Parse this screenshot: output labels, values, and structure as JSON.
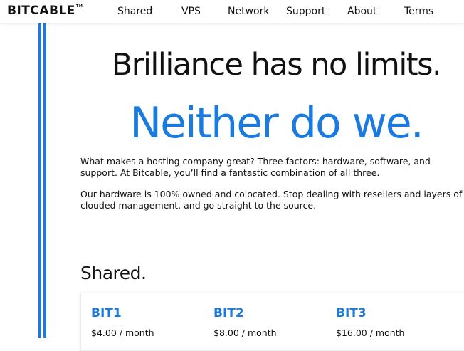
{
  "header": {
    "logo_text": "BITCABLE",
    "logo_tm": "TM",
    "nav": [
      {
        "label": "Shared"
      },
      {
        "label": "VPS"
      },
      {
        "label": "Network"
      },
      {
        "label": "Support"
      },
      {
        "label": "About"
      },
      {
        "label": "Terms"
      }
    ]
  },
  "hero": {
    "headline": "Brilliance has no limits.",
    "subheadline": "Neither do we.",
    "paragraph1": [
      "What makes a hosting company great? Three factors: hardware, software, and",
      "support. At Bitcable, you’ll find a fantastic combination of all three."
    ],
    "paragraph2": [
      "Our hardware is 100% owned and colocated. Stop dealing with resellers and layers of",
      "clouded management, and go straight to the source."
    ]
  },
  "shared": {
    "title": "Shared.",
    "plans": [
      {
        "name": "BIT1",
        "price": "$4.00 / month"
      },
      {
        "name": "BIT2",
        "price": "$8.00 / month"
      },
      {
        "name": "BIT3",
        "price": "$16.00 / month"
      }
    ]
  },
  "colors": {
    "accent": "#1a7ae0",
    "side_lines": "#2277dd"
  }
}
